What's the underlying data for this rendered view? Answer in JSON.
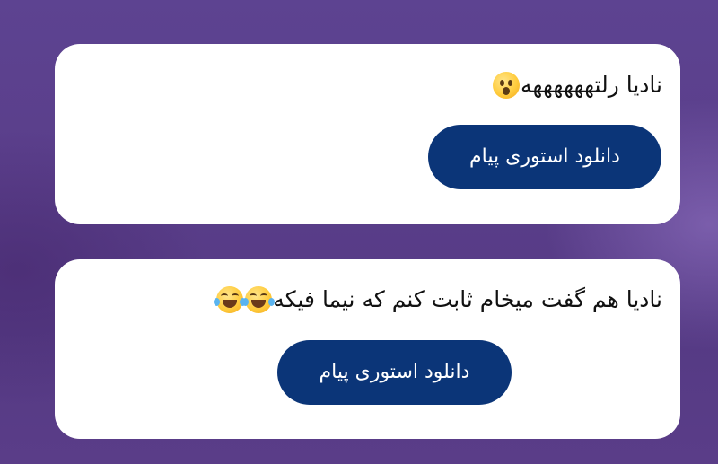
{
  "messages": [
    {
      "text": "نادیا رلتههههههه",
      "emojis": [
        "astonished-face"
      ],
      "button_label": "دانلود استوری پیام"
    },
    {
      "text": "نادیا هم گفت میخام ثابت کنم که نیما فیکه",
      "emojis": [
        "face-with-tears-of-joy",
        "face-with-tears-of-joy"
      ],
      "button_label": "دانلود استوری پیام"
    }
  ],
  "colors": {
    "button_bg": "#0b3578",
    "button_text": "#ffffff",
    "card_bg": "#ffffff",
    "background": "#5a3e8a"
  }
}
